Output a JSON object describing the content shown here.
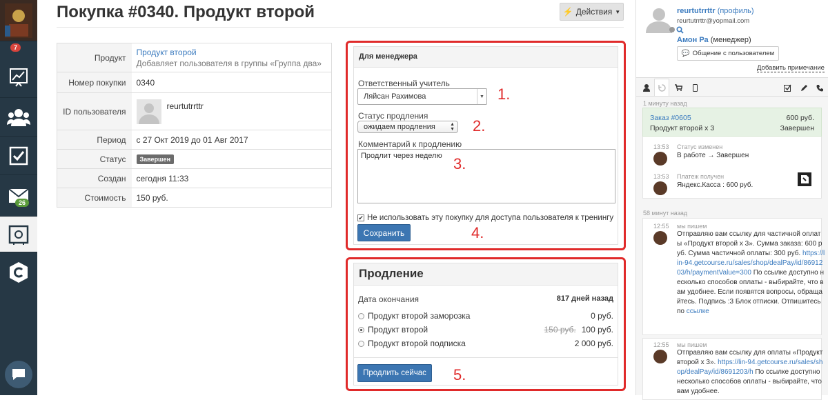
{
  "nav": {
    "badge_top": "7",
    "badge_mail": "26",
    "items": [
      "stats-icon",
      "users-icon",
      "tasks-icon",
      "mail-icon",
      "safe-icon",
      "getcourse-icon"
    ]
  },
  "header": {
    "title": "Покупка #0340. Продукт второй",
    "actions_label": "Действия"
  },
  "info": {
    "product_label": "Продукт",
    "product_link": "Продукт второй",
    "product_desc": "Добавляет пользователя в группы «Группа два»",
    "number_label": "Номер покупки",
    "number_value": "0340",
    "user_label": "ID пользователя",
    "user_value": "reurtutrrttr",
    "period_label": "Период",
    "period_value": "с 27 Окт 2019 до 01 Авг 2017",
    "status_label": "Статус",
    "status_value": "Завершен",
    "created_label": "Создан",
    "created_value": "сегодня 11:33",
    "cost_label": "Стоимость",
    "cost_value": "150 руб."
  },
  "manager": {
    "title": "Для менеджера",
    "teacher_label": "Ответственный учитель",
    "teacher_value": "Ляйсан Рахимова",
    "status_label": "Статус продления",
    "status_value": "ожидаем продления",
    "comment_label": "Комментарий к продлению",
    "comment_value": "Продлит через неделю",
    "checkbox_label": "Не использовать эту покупку для доступа пользователя к тренингу",
    "save_label": "Сохранить"
  },
  "renewal": {
    "title": "Продление",
    "end_label": "Дата окончания",
    "end_value": "817 дней назад",
    "options": [
      {
        "name": "Продукт второй заморозка",
        "old": "",
        "price": "0 руб."
      },
      {
        "name": "Продукт второй",
        "old": "150 руб.",
        "price": "100 руб."
      },
      {
        "name": "Продукт второй подписка",
        "old": "",
        "price": "2 000 руб."
      }
    ],
    "button_label": "Продлить сейчас"
  },
  "annotations": [
    "1.",
    "2.",
    "3.",
    "4.",
    "5."
  ],
  "profile": {
    "name": "reurtutrrttr",
    "profile_link": "(профиль)",
    "email": "reurtutrrttr@yopmail.com",
    "manager_name": "Амон Ра",
    "manager_role": "(менеджер)",
    "chat_button": "Общение с пользователем",
    "add_note": "Добавить примечание"
  },
  "feed": {
    "time1": "1 минуту назад",
    "order_link": "Заказ #0605",
    "order_price": "600 руб.",
    "order_item": "Продукт второй x 3",
    "order_status": "Завершен",
    "ev1_time": "13:53",
    "ev1_title": "Статус изменен",
    "ev1_body": "В работе → Завершен",
    "ev2_time": "13:53",
    "ev2_title": "Платеж получен",
    "ev2_body": "Яндекс.Касса : 600 руб.",
    "time2": "58 минут назад",
    "m1_time": "12:55",
    "m1_meta": "мы пишем",
    "m1_text_a": "Отправляю вам ссылку для частичной оплаты «Продукт второй x 3». Сумма заказа: 600 руб. Сумма частичной оплаты: 300 руб. ",
    "m1_link": "https://lin-94.getcourse.ru/sales/shop/dealPay/id/8691203/h/paymentValue=300",
    "m1_text_b": " По ссылке доступно несколько способов оплаты - выбирайте, что вам удобнее. Если появятся вопросы, обращайтесь. Подпись :3 Блок отписки. Отпишитесь по ",
    "m1_link2": "ссылке",
    "m2_time": "12:55",
    "m2_meta": "мы пишем",
    "m2_text_a": "Отправляю вам ссылку для оплаты «Продукт второй x 3». ",
    "m2_link": "https://lin-94.getcourse.ru/sales/shop/dealPay/id/8691203/h",
    "m2_text_b": " По ссылке доступно несколько способов оплаты - выбирайте, что вам удобнее."
  }
}
